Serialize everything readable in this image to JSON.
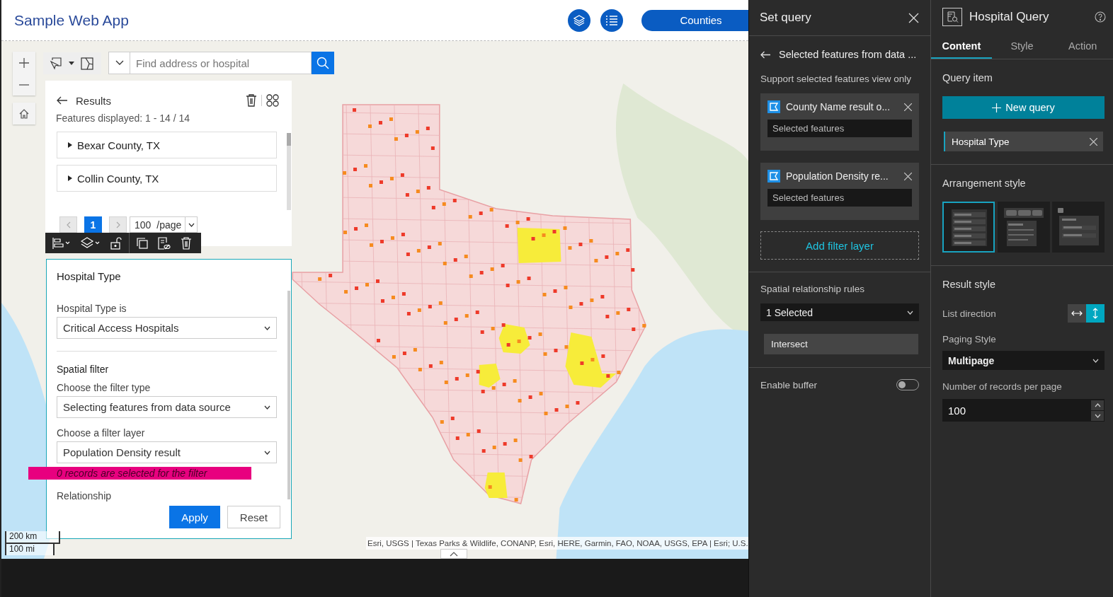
{
  "app_title": "Sample Web App",
  "header": {
    "counties_button": "Counties"
  },
  "search": {
    "placeholder": "Find address or hospital"
  },
  "results": {
    "title": "Results",
    "summary": "Features displayed: 1 - 14 / 14",
    "items": [
      {
        "label": "Bexar County, TX",
        "expanded": false
      },
      {
        "label": "Collin County, TX",
        "expanded": false
      }
    ],
    "pages": [
      {
        "label": "1",
        "selected": true
      }
    ],
    "page_size": "100",
    "page_size_unit": "/page"
  },
  "query_form": {
    "title": "Hospital Type",
    "attribute_label": "Hospital Type is",
    "attribute_value": "Critical Access Hospitals",
    "spatial_title": "Spatial filter",
    "filter_type_label": "Choose the filter type",
    "filter_type_value": "Selecting features from data source",
    "filter_layer_label": "Choose a filter layer",
    "filter_layer_value": "Population Density result",
    "notice": "0 records are selected for the filter",
    "relationship_label": "Relationship",
    "buttons": [
      {
        "label": "Apply",
        "primary": true
      },
      {
        "label": "Reset",
        "primary": false
      }
    ]
  },
  "map": {
    "scale": [
      "200 km",
      "100 mi"
    ],
    "attribution": "Esri, USGS | Texas Parks & Wildlife, CONANP, Esri, HERE, Garmin, FAO, NOAA, USGS, EPA | Esri; U.S."
  },
  "set_query": {
    "title": "Set query",
    "subtitle": "Selected features from data ...",
    "note": "Support selected features view only",
    "layers": [
      {
        "name": "County Name result o...",
        "mode": "Selected features"
      },
      {
        "name": "Population Density re...",
        "mode": "Selected features"
      }
    ],
    "add_layer": "Add filter layer",
    "rules_label": "Spatial relationship rules",
    "rules_value": "1 Selected",
    "rules": [
      "Intersect"
    ],
    "buffer_label": "Enable buffer",
    "buffer_on": false
  },
  "settings": {
    "title": "Hospital Query",
    "tabs": [
      {
        "label": "Content",
        "selected": true
      },
      {
        "label": "Style",
        "selected": false
      },
      {
        "label": "Action",
        "selected": false
      }
    ],
    "query_item_label": "Query item",
    "new_query": "New query",
    "items": [
      {
        "label": "Hospital Type",
        "selected": true
      }
    ],
    "arrangement_label": "Arrangement style",
    "arrangements": [
      {
        "kind": "list",
        "selected": true
      },
      {
        "kind": "tabs",
        "selected": false
      },
      {
        "kind": "dropdown",
        "selected": false
      }
    ],
    "result_style_label": "Result style",
    "list_direction_label": "List direction",
    "directions": [
      {
        "kind": "horizontal",
        "selected": false
      },
      {
        "kind": "vertical",
        "selected": true
      }
    ],
    "paging_label": "Paging Style",
    "paging_value": "Multipage",
    "records_label": "Number of records per page",
    "records_value": "100"
  }
}
